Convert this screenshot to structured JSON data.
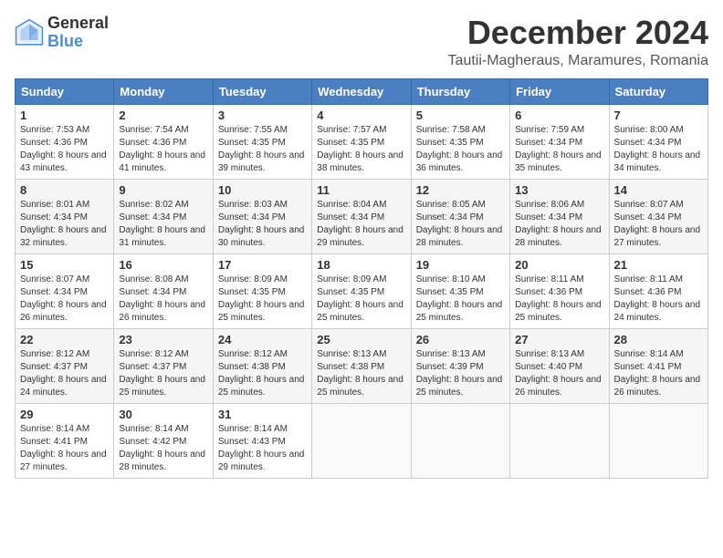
{
  "header": {
    "logo_general": "General",
    "logo_blue": "Blue",
    "title": "December 2024",
    "subtitle": "Tautii-Magheraus, Maramures, Romania"
  },
  "calendar": {
    "headers": [
      "Sunday",
      "Monday",
      "Tuesday",
      "Wednesday",
      "Thursday",
      "Friday",
      "Saturday"
    ],
    "weeks": [
      [
        {
          "day": "1",
          "sunrise": "7:53 AM",
          "sunset": "4:36 PM",
          "daylight": "8 hours and 43 minutes."
        },
        {
          "day": "2",
          "sunrise": "7:54 AM",
          "sunset": "4:36 PM",
          "daylight": "8 hours and 41 minutes."
        },
        {
          "day": "3",
          "sunrise": "7:55 AM",
          "sunset": "4:35 PM",
          "daylight": "8 hours and 39 minutes."
        },
        {
          "day": "4",
          "sunrise": "7:57 AM",
          "sunset": "4:35 PM",
          "daylight": "8 hours and 38 minutes."
        },
        {
          "day": "5",
          "sunrise": "7:58 AM",
          "sunset": "4:35 PM",
          "daylight": "8 hours and 36 minutes."
        },
        {
          "day": "6",
          "sunrise": "7:59 AM",
          "sunset": "4:34 PM",
          "daylight": "8 hours and 35 minutes."
        },
        {
          "day": "7",
          "sunrise": "8:00 AM",
          "sunset": "4:34 PM",
          "daylight": "8 hours and 34 minutes."
        }
      ],
      [
        {
          "day": "8",
          "sunrise": "8:01 AM",
          "sunset": "4:34 PM",
          "daylight": "8 hours and 32 minutes."
        },
        {
          "day": "9",
          "sunrise": "8:02 AM",
          "sunset": "4:34 PM",
          "daylight": "8 hours and 31 minutes."
        },
        {
          "day": "10",
          "sunrise": "8:03 AM",
          "sunset": "4:34 PM",
          "daylight": "8 hours and 30 minutes."
        },
        {
          "day": "11",
          "sunrise": "8:04 AM",
          "sunset": "4:34 PM",
          "daylight": "8 hours and 29 minutes."
        },
        {
          "day": "12",
          "sunrise": "8:05 AM",
          "sunset": "4:34 PM",
          "daylight": "8 hours and 28 minutes."
        },
        {
          "day": "13",
          "sunrise": "8:06 AM",
          "sunset": "4:34 PM",
          "daylight": "8 hours and 28 minutes."
        },
        {
          "day": "14",
          "sunrise": "8:07 AM",
          "sunset": "4:34 PM",
          "daylight": "8 hours and 27 minutes."
        }
      ],
      [
        {
          "day": "15",
          "sunrise": "8:07 AM",
          "sunset": "4:34 PM",
          "daylight": "8 hours and 26 minutes."
        },
        {
          "day": "16",
          "sunrise": "8:08 AM",
          "sunset": "4:34 PM",
          "daylight": "8 hours and 26 minutes."
        },
        {
          "day": "17",
          "sunrise": "8:09 AM",
          "sunset": "4:35 PM",
          "daylight": "8 hours and 25 minutes."
        },
        {
          "day": "18",
          "sunrise": "8:09 AM",
          "sunset": "4:35 PM",
          "daylight": "8 hours and 25 minutes."
        },
        {
          "day": "19",
          "sunrise": "8:10 AM",
          "sunset": "4:35 PM",
          "daylight": "8 hours and 25 minutes."
        },
        {
          "day": "20",
          "sunrise": "8:11 AM",
          "sunset": "4:36 PM",
          "daylight": "8 hours and 25 minutes."
        },
        {
          "day": "21",
          "sunrise": "8:11 AM",
          "sunset": "4:36 PM",
          "daylight": "8 hours and 24 minutes."
        }
      ],
      [
        {
          "day": "22",
          "sunrise": "8:12 AM",
          "sunset": "4:37 PM",
          "daylight": "8 hours and 24 minutes."
        },
        {
          "day": "23",
          "sunrise": "8:12 AM",
          "sunset": "4:37 PM",
          "daylight": "8 hours and 25 minutes."
        },
        {
          "day": "24",
          "sunrise": "8:12 AM",
          "sunset": "4:38 PM",
          "daylight": "8 hours and 25 minutes."
        },
        {
          "day": "25",
          "sunrise": "8:13 AM",
          "sunset": "4:38 PM",
          "daylight": "8 hours and 25 minutes."
        },
        {
          "day": "26",
          "sunrise": "8:13 AM",
          "sunset": "4:39 PM",
          "daylight": "8 hours and 25 minutes."
        },
        {
          "day": "27",
          "sunrise": "8:13 AM",
          "sunset": "4:40 PM",
          "daylight": "8 hours and 26 minutes."
        },
        {
          "day": "28",
          "sunrise": "8:14 AM",
          "sunset": "4:41 PM",
          "daylight": "8 hours and 26 minutes."
        }
      ],
      [
        {
          "day": "29",
          "sunrise": "8:14 AM",
          "sunset": "4:41 PM",
          "daylight": "8 hours and 27 minutes."
        },
        {
          "day": "30",
          "sunrise": "8:14 AM",
          "sunset": "4:42 PM",
          "daylight": "8 hours and 28 minutes."
        },
        {
          "day": "31",
          "sunrise": "8:14 AM",
          "sunset": "4:43 PM",
          "daylight": "8 hours and 29 minutes."
        },
        null,
        null,
        null,
        null
      ]
    ]
  }
}
